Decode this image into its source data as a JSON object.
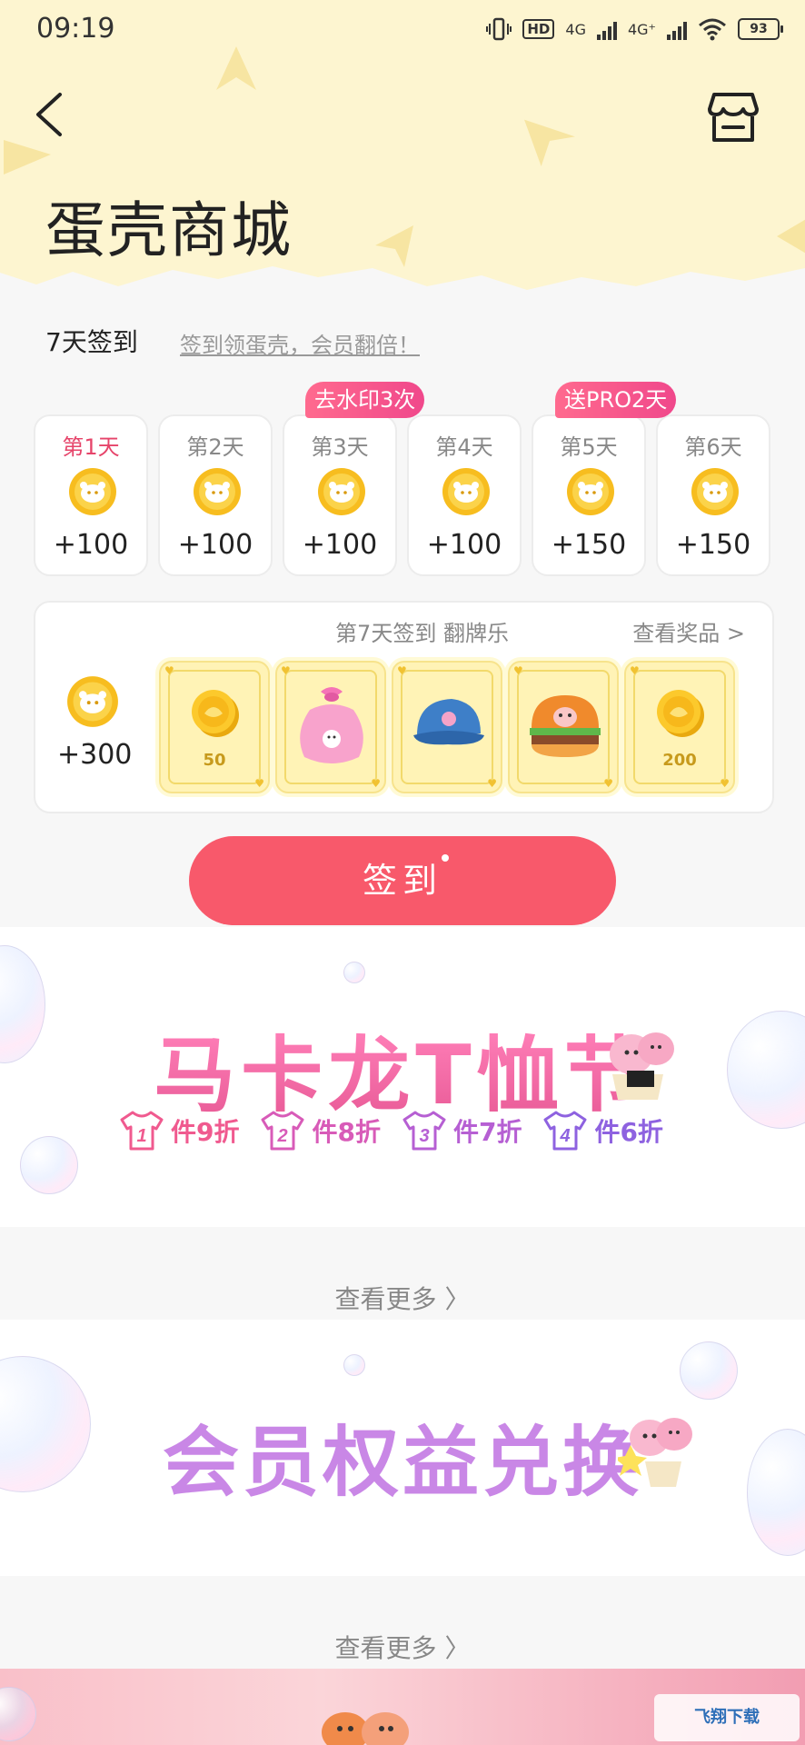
{
  "status": {
    "time": "09:19",
    "hd": "HD",
    "net1": "4G",
    "net2": "4G⁺",
    "battery": "93"
  },
  "header": {
    "title": "蛋壳商城"
  },
  "sign": {
    "label": "7天签到",
    "subtitle": "签到领蛋壳，会员翻倍！",
    "tags": [
      "去水印3次",
      "送PRO2天"
    ],
    "days": [
      {
        "label": "第1天",
        "value": "+100"
      },
      {
        "label": "第2天",
        "value": "+100"
      },
      {
        "label": "第3天",
        "value": "+100"
      },
      {
        "label": "第4天",
        "value": "+100"
      },
      {
        "label": "第5天",
        "value": "+150"
      },
      {
        "label": "第6天",
        "value": "+150"
      }
    ],
    "flip": {
      "title": "第7天签到 翻牌乐",
      "link": "查看奖品 >",
      "value": "+300",
      "prizes": [
        "50",
        "",
        "",
        "",
        "200"
      ]
    },
    "button": "签到"
  },
  "banner1": {
    "title": "马卡龙T恤节",
    "offers": [
      {
        "num": "1",
        "text": "件9折",
        "color": "#f05a8f"
      },
      {
        "num": "2",
        "text": "件8折",
        "color": "#d85bb8"
      },
      {
        "num": "3",
        "text": "件7折",
        "color": "#b65fd3"
      },
      {
        "num": "4",
        "text": "件6折",
        "color": "#8e62e0"
      }
    ]
  },
  "more": "查看更多 〉",
  "banner2": {
    "title": "会员权益兑换"
  },
  "watermark": "飞翔下载"
}
